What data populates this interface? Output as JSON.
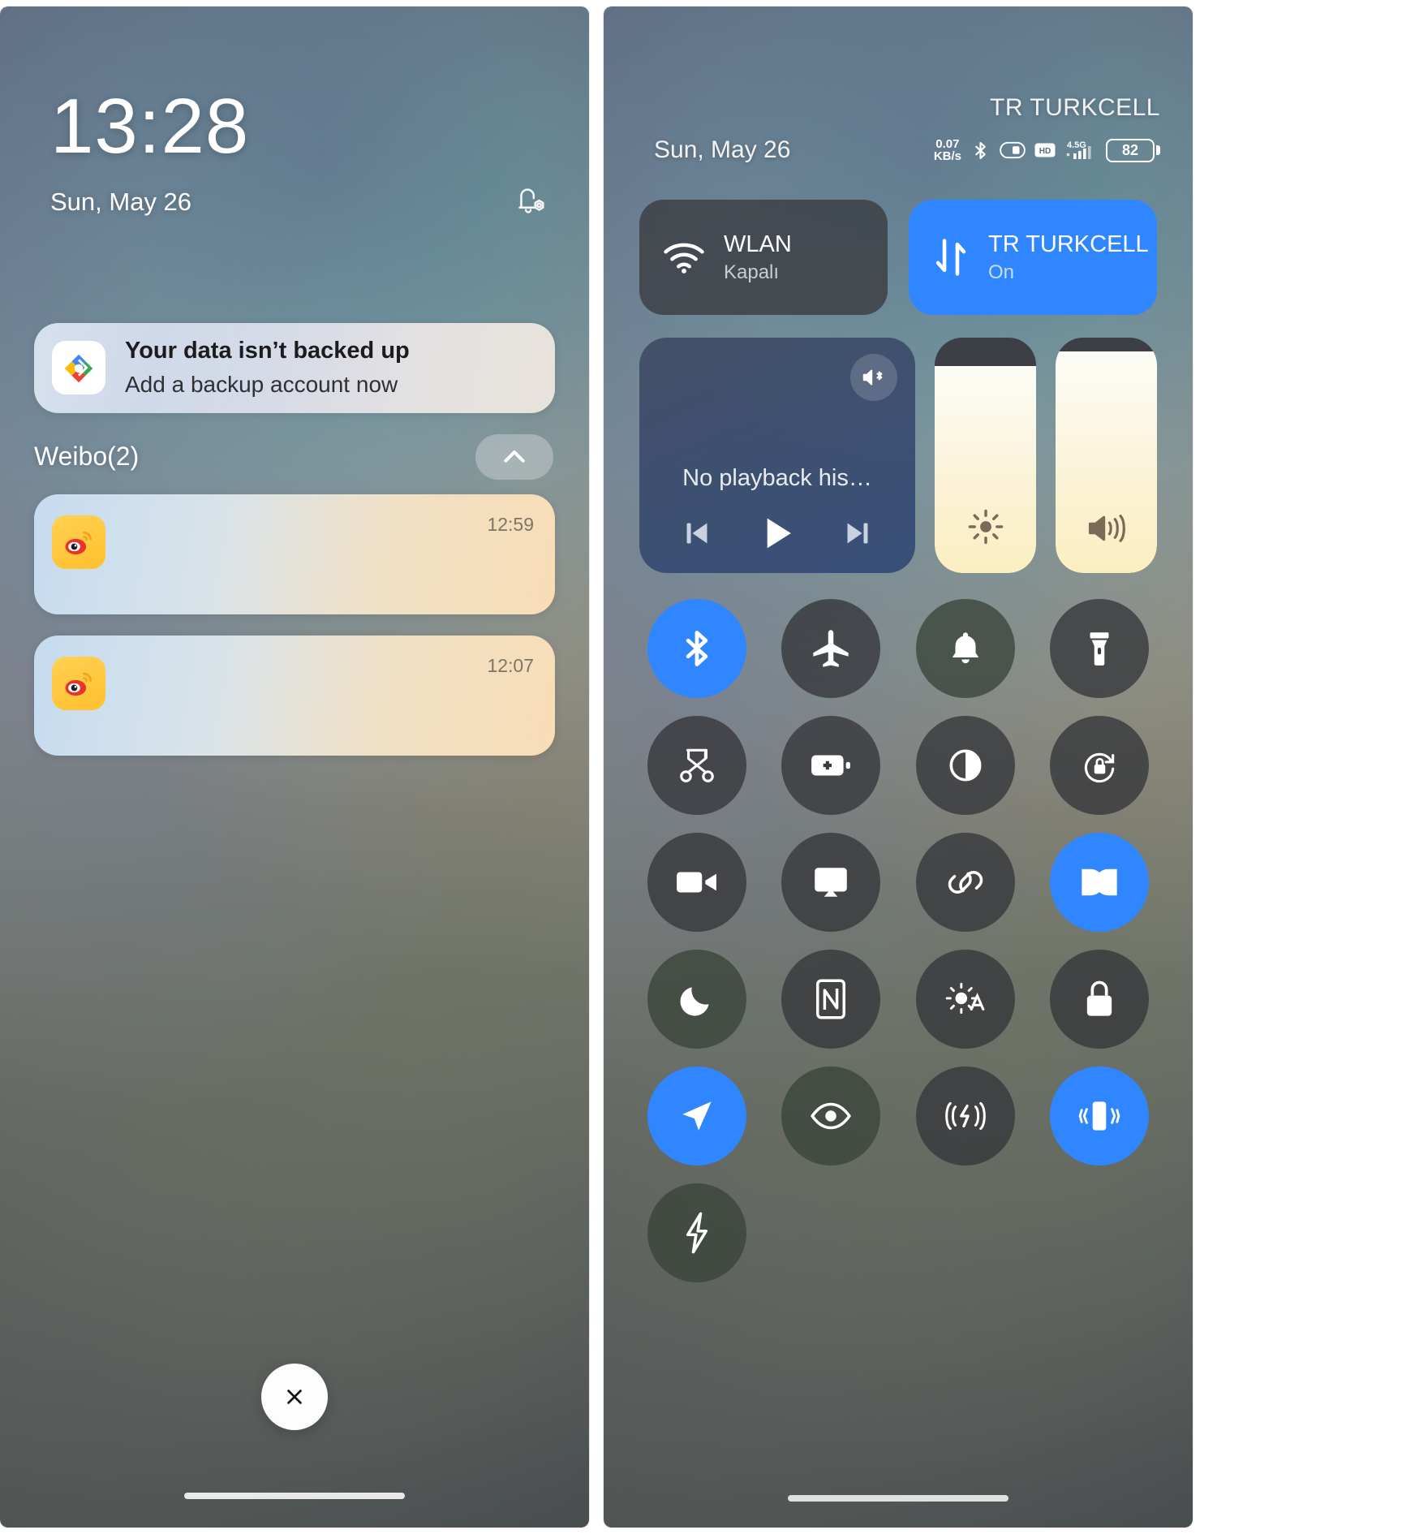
{
  "lockscreen": {
    "clock": "13:28",
    "date": "Sun, May 26",
    "bell_icon": "notification-bell-icon",
    "notifications": [
      {
        "icon": "google-backup-icon",
        "title": "Your data isn’t backed up",
        "body": "Add a backup account now"
      }
    ],
    "group": {
      "title": "Weibo(2)",
      "collapse_icon": "chevron-up-icon",
      "items": [
        {
          "icon": "weibo-icon",
          "time": "12:59"
        },
        {
          "icon": "weibo-icon",
          "time": "12:07"
        }
      ]
    },
    "close_button_icon": "close-x-icon"
  },
  "control_center": {
    "carrier": "TR TURKCELL",
    "date": "Sun, May 26",
    "status_icons": {
      "net_speed_value": "0.07",
      "net_speed_unit": "KB/s",
      "bluetooth": "bluetooth-icon",
      "dnd": "do-not-disturb-icon",
      "hd": "HD",
      "network_type": "4.5G",
      "signal": "signal-bars-icon",
      "battery_percent": "82"
    },
    "tiles": [
      {
        "name": "wlan",
        "icon": "wifi-icon",
        "label": "WLAN",
        "sub": "Kapalı",
        "state": "off"
      },
      {
        "name": "mobile-data",
        "icon": "data-arrows-icon",
        "label": "TR TURKCELL",
        "sub": "On",
        "state": "on"
      }
    ],
    "media": {
      "output_icon": "bluetooth-speaker-icon",
      "title": "No playback his…",
      "prev_icon": "skip-previous-icon",
      "play_icon": "play-icon",
      "next_icon": "skip-next-icon"
    },
    "sliders": [
      {
        "name": "brightness",
        "icon": "brightness-sun-icon",
        "value": 88
      },
      {
        "name": "volume",
        "icon": "volume-speaker-icon",
        "value": 94
      }
    ],
    "toggles": [
      {
        "name": "bluetooth",
        "icon": "bluetooth-icon",
        "state": "on"
      },
      {
        "name": "airplane-mode",
        "icon": "airplane-icon",
        "state": "off"
      },
      {
        "name": "ringer",
        "icon": "bell-icon",
        "state": "off"
      },
      {
        "name": "flashlight",
        "icon": "flashlight-icon",
        "state": "off"
      },
      {
        "name": "screenshot",
        "icon": "scissors-icon",
        "state": "off"
      },
      {
        "name": "battery-saver",
        "icon": "battery-plus-icon",
        "state": "off"
      },
      {
        "name": "dark-mode",
        "icon": "contrast-circle-icon",
        "state": "off"
      },
      {
        "name": "auto-rotate",
        "icon": "rotation-lock-icon",
        "state": "off"
      },
      {
        "name": "screen-record",
        "icon": "video-camera-icon",
        "state": "off"
      },
      {
        "name": "cast",
        "icon": "cast-screen-icon",
        "state": "off"
      },
      {
        "name": "link-share",
        "icon": "link-chain-icon",
        "state": "off"
      },
      {
        "name": "audio-effects",
        "icon": "dolby-icon",
        "state": "on"
      },
      {
        "name": "do-not-disturb",
        "icon": "moon-icon",
        "state": "off"
      },
      {
        "name": "nfc",
        "icon": "nfc-icon",
        "state": "off"
      },
      {
        "name": "auto-brightness",
        "icon": "auto-brightness-icon",
        "state": "off"
      },
      {
        "name": "lock-screen",
        "icon": "padlock-icon",
        "state": "off"
      },
      {
        "name": "location",
        "icon": "location-arrow-icon",
        "state": "on"
      },
      {
        "name": "eye-comfort",
        "icon": "eye-icon",
        "state": "off"
      },
      {
        "name": "wireless-charge-share",
        "icon": "wireless-power-icon",
        "state": "off"
      },
      {
        "name": "vibrate",
        "icon": "vibrate-phone-icon",
        "state": "on"
      },
      {
        "name": "quick-charge",
        "icon": "lightning-bolt-icon",
        "state": "off"
      }
    ]
  },
  "colors": {
    "accent_blue": "#2f86ff",
    "tile_off": "#3a3c40",
    "slider_fill": "#fbf0c6"
  }
}
